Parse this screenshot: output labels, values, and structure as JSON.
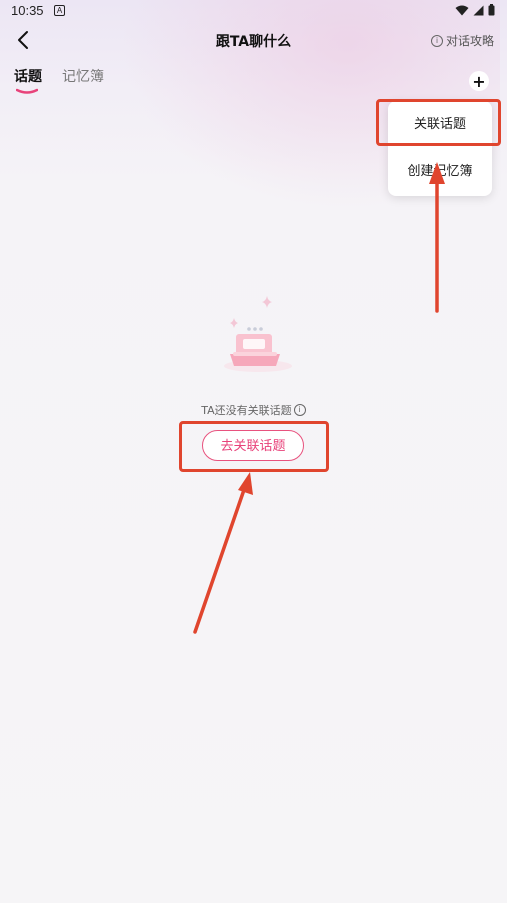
{
  "status": {
    "time": "10:35",
    "notif_glyph": "A"
  },
  "header": {
    "title": "跟TA聊什么",
    "guide_label": "对话攻略",
    "info_glyph": "i"
  },
  "tabs": [
    {
      "label": "话题"
    },
    {
      "label": "记忆簿"
    }
  ],
  "add_glyph": "+",
  "menu": {
    "items": [
      {
        "label": "关联话题"
      },
      {
        "label": "创建记忆簿"
      }
    ]
  },
  "empty": {
    "text": "TA还没有关联话题",
    "info_glyph": "i",
    "button_label": "去关联话题"
  },
  "colors": {
    "accent": "#e8427a",
    "annotation": "#e0452e"
  }
}
